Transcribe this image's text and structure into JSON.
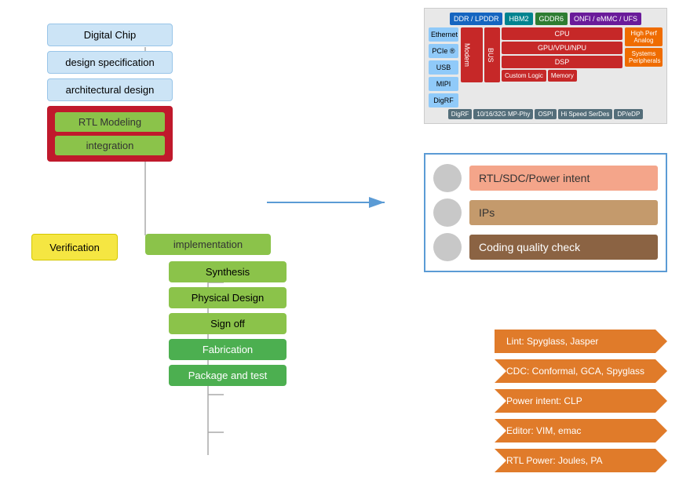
{
  "left_flow": {
    "digital_chip": "Digital Chip",
    "design_spec": "design specification",
    "arch_design": "architectural design",
    "rtl_modeling": "RTL Modeling",
    "integration": "integration"
  },
  "verification": "Verification",
  "implementation": {
    "header": "implementation",
    "steps": [
      "Synthesis",
      "Physical Design",
      "Sign off",
      "Fabrication",
      "Package and test"
    ]
  },
  "soc": {
    "top_chips": [
      "DDR / LPDDR",
      "HBM2",
      "GDDR6",
      "ONFI / eMMC / UFS"
    ],
    "left_labels": [
      "Ethernet",
      "PCIe ®",
      "USB",
      "MIPI",
      "DigRF"
    ],
    "center_chips": [
      "Modem",
      "BUS",
      "CPU",
      "GPU/VPU/NPU",
      "DSP",
      "Custom Logic",
      "Memory"
    ],
    "right_chips": [
      "High Perf Analog",
      "Systems Peripherals"
    ],
    "bottom_chips": [
      "10/16/32G MP-Phy",
      "OSPI",
      "Hi Speed SerDes",
      "DP/eDP"
    ]
  },
  "rtl_panel": {
    "item1": "RTL/SDC/Power intent",
    "item2": "IPs",
    "item3": "Coding quality check"
  },
  "arrows": [
    "Lint: Spyglass, Jasper",
    "CDC: Conformal, GCA, Spyglass",
    "Power intent: CLP",
    "Editor: VIM, emac",
    "RTL Power: Joules, PA"
  ]
}
